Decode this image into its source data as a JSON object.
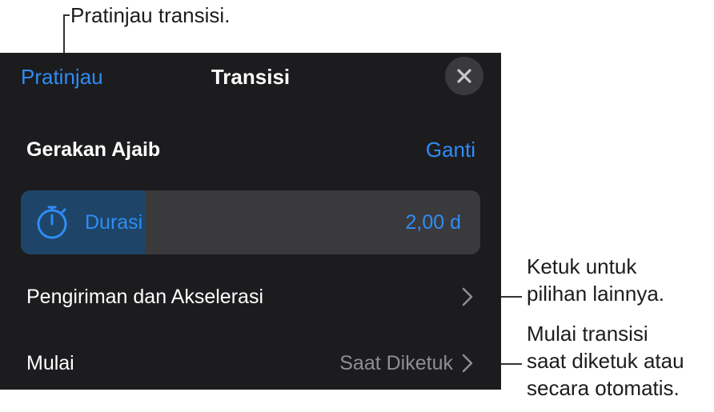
{
  "callouts": {
    "preview_note": "Pratinjau transisi.",
    "more_options_note": "Ketuk untuk\npilihan lainnya.",
    "start_note": "Mulai transisi\nsaat diketuk atau\nsecara otomatis."
  },
  "header": {
    "preview_label": "Pratinjau",
    "title": "Transisi",
    "close_icon": "close-icon"
  },
  "effect": {
    "name": "Gerakan Ajaib",
    "change_label": "Ganti"
  },
  "duration": {
    "icon": "stopwatch-icon",
    "label": "Durasi",
    "value": "2,00 d",
    "slider_fraction": 0.27
  },
  "rows": {
    "delivery_label": "Pengiriman dan Akselerasi",
    "start_label": "Mulai",
    "start_value": "Saat Diketuk"
  },
  "colors": {
    "panel_bg": "#1c1c1e",
    "accent": "#2f8cf6",
    "secondary_text": "#8e8e93"
  }
}
